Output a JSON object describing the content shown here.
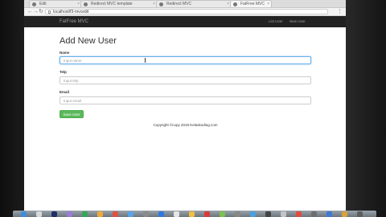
{
  "browser": {
    "tabs": [
      {
        "label": "Edit",
        "active": false
      },
      {
        "label": "Redirect MVC template",
        "active": false
      },
      {
        "label": "Redirect MVC",
        "active": false
      },
      {
        "label": "FatFree MVC",
        "active": true
      }
    ],
    "url": "localhost/f3-mvcedit"
  },
  "app": {
    "brand": "FatFree MVC",
    "nav": [
      "List User",
      "New User"
    ]
  },
  "form": {
    "title": "Add New User",
    "fields": [
      {
        "label": "Name",
        "placeholder": "Input name",
        "focused": true
      },
      {
        "label": "Telp",
        "placeholder": "Input telp",
        "focused": false
      },
      {
        "label": "Email",
        "placeholder": "Input email",
        "focused": false
      }
    ],
    "submit_label": "Save User"
  },
  "footer": {
    "copyright": "Copyright ©copy 2018 Kelaskoding.com"
  },
  "icons": {
    "back": "←",
    "forward": "→",
    "reload": "↻",
    "menu": "⋮",
    "close": "×"
  },
  "dock_colors": [
    "#3f8edb",
    "#d9d9d9",
    "#1f2f6a",
    "#9c7bd6",
    "#34a853",
    "#f2a93b",
    "#e15241",
    "#5aa3e8",
    "#8b8b8b",
    "#2d7be0",
    "#e6e6e6",
    "#f0c040",
    "#d93b3b",
    "#7cc24f",
    "#888888",
    "#4aa0e0",
    "#444444",
    "#c4c4c4",
    "#e24c3f",
    "#6e6e6e",
    "#3e7ad6",
    "#d9a23a",
    "#5d5d5d"
  ]
}
